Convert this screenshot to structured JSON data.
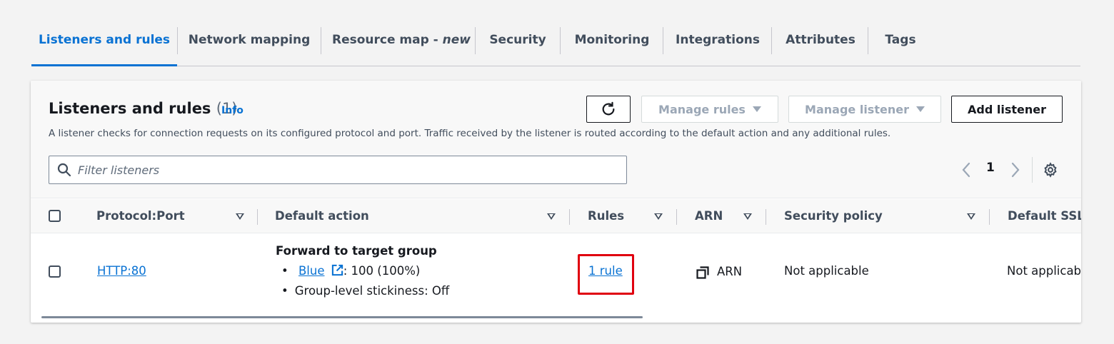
{
  "tabs": [
    {
      "label": "Listeners and rules",
      "active": true
    },
    {
      "label": "Network mapping"
    },
    {
      "label": "Resource map - ",
      "suffix": "new"
    },
    {
      "label": "Security"
    },
    {
      "label": "Monitoring"
    },
    {
      "label": "Integrations"
    },
    {
      "label": "Attributes"
    },
    {
      "label": "Tags"
    }
  ],
  "panel": {
    "title": "Listeners and rules",
    "count": "(1)",
    "info": "Info",
    "description": "A listener checks for connection requests on its configured protocol and port. Traffic received by the listener is routed according to the default action and any additional rules.",
    "buttons": {
      "refresh_icon": "refresh-icon",
      "manage_rules": "Manage rules",
      "manage_listener": "Manage listener",
      "add_listener": "Add listener"
    },
    "filter_placeholder": "Filter listeners",
    "pagination": {
      "current_page": "1"
    }
  },
  "table": {
    "columns": [
      "Protocol:Port",
      "Default action",
      "Rules",
      "ARN",
      "Security policy",
      "Default SSL/"
    ],
    "rows": [
      {
        "protocol_port": "HTTP:80",
        "action_title": "Forward to target group",
        "target_group": "Blue",
        "weight": ": 100 (100%)",
        "stickiness": "Group-level stickiness: Off",
        "rules": "1 rule",
        "arn": "ARN",
        "security_policy": "Not applicable",
        "default_ssl": "Not applicabl"
      }
    ]
  },
  "colors": {
    "accent": "#0972d3",
    "highlight": "#e0000f"
  }
}
